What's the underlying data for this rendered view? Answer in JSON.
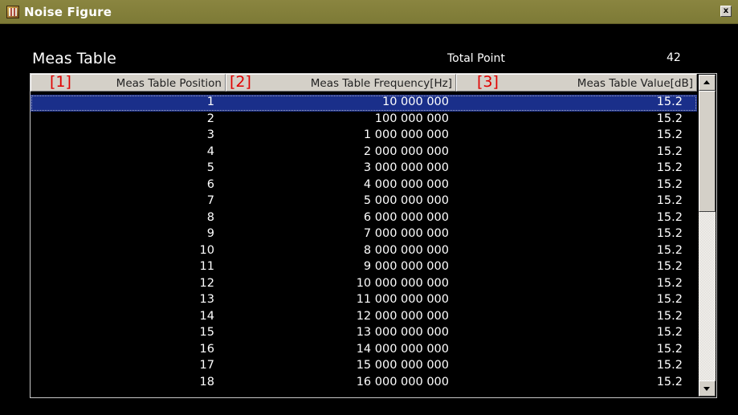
{
  "window": {
    "title": "Noise Figure",
    "close_label": "x"
  },
  "panel": {
    "title": "Meas Table",
    "total_point_label": "Total Point",
    "total_point_value": "42"
  },
  "table": {
    "columns": [
      {
        "index_label": "[1]",
        "label": "Meas Table Position"
      },
      {
        "index_label": "[2]",
        "label": "Meas Table Frequency[Hz]"
      },
      {
        "index_label": "[3]",
        "label": "Meas Table Value[dB]"
      }
    ],
    "selected_row": 0,
    "rows": [
      {
        "position": "1",
        "frequency": "10 000 000",
        "value": "15.2"
      },
      {
        "position": "2",
        "frequency": "100 000 000",
        "value": "15.2"
      },
      {
        "position": "3",
        "frequency": "1 000 000 000",
        "value": "15.2"
      },
      {
        "position": "4",
        "frequency": "2 000 000 000",
        "value": "15.2"
      },
      {
        "position": "5",
        "frequency": "3 000 000 000",
        "value": "15.2"
      },
      {
        "position": "6",
        "frequency": "4 000 000 000",
        "value": "15.2"
      },
      {
        "position": "7",
        "frequency": "5 000 000 000",
        "value": "15.2"
      },
      {
        "position": "8",
        "frequency": "6 000 000 000",
        "value": "15.2"
      },
      {
        "position": "9",
        "frequency": "7 000 000 000",
        "value": "15.2"
      },
      {
        "position": "10",
        "frequency": "8 000 000 000",
        "value": "15.2"
      },
      {
        "position": "11",
        "frequency": "9 000 000 000",
        "value": "15.2"
      },
      {
        "position": "12",
        "frequency": "10 000 000 000",
        "value": "15.2"
      },
      {
        "position": "13",
        "frequency": "11 000 000 000",
        "value": "15.2"
      },
      {
        "position": "14",
        "frequency": "12 000 000 000",
        "value": "15.2"
      },
      {
        "position": "15",
        "frequency": "13 000 000 000",
        "value": "15.2"
      },
      {
        "position": "16",
        "frequency": "14 000 000 000",
        "value": "15.2"
      },
      {
        "position": "17",
        "frequency": "15 000 000 000",
        "value": "15.2"
      },
      {
        "position": "18",
        "frequency": "16 000 000 000",
        "value": "15.2"
      }
    ]
  }
}
